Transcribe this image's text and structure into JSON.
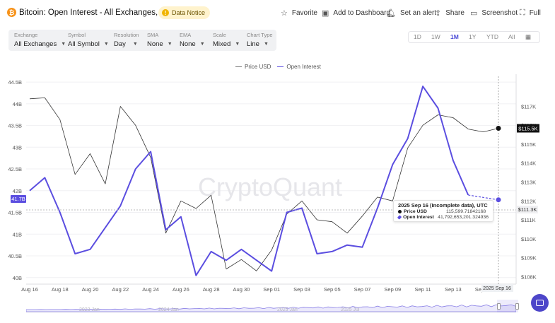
{
  "header": {
    "title": "Bitcoin: Open Interest - All Exchanges, All Symbol",
    "notice": "Data Notice",
    "buttons": {
      "favorite": "Favorite",
      "add_to_dashboard": "Add to Dashboard",
      "set_alert": "Set an alert",
      "share": "Share",
      "screenshot": "Screenshot",
      "full": "Full"
    }
  },
  "controls": [
    {
      "label": "Exchange",
      "value": "All Exchanges"
    },
    {
      "label": "Symbol",
      "value": "All Symbol"
    },
    {
      "label": "Resolution",
      "value": "Day"
    },
    {
      "label": "SMA",
      "value": "None"
    },
    {
      "label": "EMA",
      "value": "None"
    },
    {
      "label": "Scale",
      "value": "Mixed"
    },
    {
      "label": "Chart Type",
      "value": "Line"
    }
  ],
  "ranges": {
    "items": [
      "1D",
      "1W",
      "1M",
      "1Y",
      "YTD",
      "All"
    ],
    "active": "1M"
  },
  "colors": {
    "accent": "#5b4ee0",
    "price": "#222222",
    "oi": "#5b4ee0",
    "brand_orange": "#f7931a"
  },
  "legend": {
    "price": "Price USD",
    "oi": "Open Interest"
  },
  "watermark": "CryptoQuant",
  "chart_data": {
    "type": "line",
    "x": [
      "Aug 16",
      "Aug 17",
      "Aug 18",
      "Aug 19",
      "Aug 20",
      "Aug 21",
      "Aug 22",
      "Aug 23",
      "Aug 24",
      "Aug 25",
      "Aug 26",
      "Aug 27",
      "Aug 28",
      "Aug 29",
      "Aug 30",
      "Aug 31",
      "Sep 01",
      "Sep 02",
      "Sep 03",
      "Sep 04",
      "Sep 05",
      "Sep 06",
      "Sep 07",
      "Sep 08",
      "Sep 09",
      "Sep 10",
      "Sep 11",
      "Sep 12",
      "Sep 13",
      "Sep 14",
      "Sep 15",
      "Sep 16"
    ],
    "x_tick_labels": [
      "Aug 16",
      "Aug 18",
      "Aug 20",
      "Aug 22",
      "Aug 24",
      "Aug 26",
      "Aug 28",
      "Aug 30",
      "Sep 01",
      "Sep 03",
      "Sep 05",
      "Sep 07",
      "Sep 09",
      "Sep 11",
      "Sep 13",
      "Sep 15"
    ],
    "series": [
      {
        "name": "Price USD",
        "axis": "right",
        "values": [
          117400,
          117450,
          116300,
          113400,
          114500,
          112900,
          117000,
          116000,
          114300,
          110300,
          112000,
          111600,
          112300,
          108400,
          108900,
          108300,
          109400,
          111300,
          112000,
          111000,
          110900,
          110300,
          111200,
          112200,
          112000,
          114800,
          116000,
          116550,
          116400,
          115800,
          115650,
          115840
        ]
      },
      {
        "name": "Open Interest",
        "axis": "left",
        "values": [
          42.0,
          42.3,
          41.5,
          40.55,
          40.65,
          41.15,
          41.65,
          42.5,
          42.9,
          41.1,
          41.4,
          40.05,
          40.6,
          40.4,
          40.65,
          40.4,
          40.15,
          41.5,
          41.6,
          40.55,
          40.6,
          40.75,
          40.7,
          41.6,
          42.6,
          43.2,
          44.4,
          43.9,
          42.7,
          41.9,
          null,
          41.79
        ]
      }
    ],
    "left_axis": {
      "ticks": [
        "40B",
        "40.5B",
        "41B",
        "41.5B",
        "42B",
        "42.5B",
        "43B",
        "43.5B",
        "44B",
        "44.5B"
      ],
      "ylim": [
        39.85,
        44.55
      ]
    },
    "right_axis": {
      "ticks": [
        "$108K",
        "$109K",
        "$110K",
        "$111K",
        "$112K",
        "$113K",
        "$114K",
        "$115K",
        "$116K",
        "$117K"
      ],
      "ylim": [
        107.6,
        118.4
      ]
    },
    "crosshair": {
      "x": "2025 Sep 16",
      "left_value": "41.7B",
      "right_value": "$111.3K",
      "last_price_label": "$115.5K"
    },
    "navigator_labels": [
      "2023 Jan",
      "2024 Jan",
      "2025 Jan",
      "2025 Jul"
    ]
  },
  "tooltip": {
    "title": "2025 Sep 16 (Incomplete data), UTC",
    "price_label": "Price USD",
    "price_value": "115,599.71842168",
    "oi_label": "Open Interest",
    "oi_value": "41,792,653,201.324936"
  }
}
